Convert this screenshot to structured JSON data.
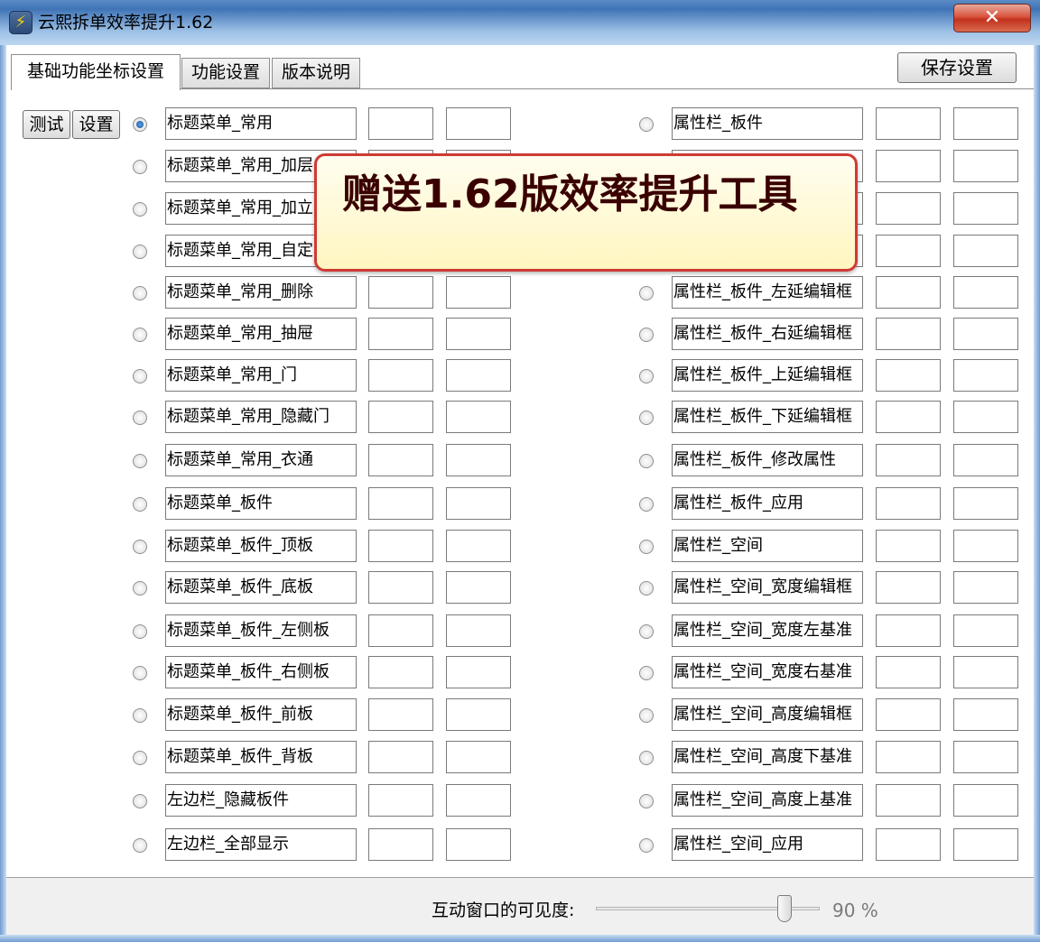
{
  "window": {
    "title": "云熙拆单效率提升1.62",
    "close_label": "✕",
    "app_icon_glyph": "⚡"
  },
  "tabs": [
    {
      "label": "基础功能坐标设置",
      "active": true
    },
    {
      "label": "功能设置",
      "active": false
    },
    {
      "label": "版本说明",
      "active": false
    }
  ],
  "toolbar": {
    "save_label": "保存设置",
    "test_label": "测试",
    "set_label": "设置"
  },
  "left_items": [
    {
      "label": "标题菜单_常用",
      "checked": true
    },
    {
      "label": "标题菜单_常用_加层",
      "checked": false
    },
    {
      "label": "标题菜单_常用_加立",
      "checked": false
    },
    {
      "label": "标题菜单_常用_自定",
      "checked": false
    },
    {
      "label": "标题菜单_常用_删除",
      "checked": false
    },
    {
      "label": "标题菜单_常用_抽屉",
      "checked": false
    },
    {
      "label": "标题菜单_常用_门",
      "checked": false
    },
    {
      "label": "标题菜单_常用_隐藏门",
      "checked": false
    },
    {
      "label": "标题菜单_常用_衣通",
      "checked": false
    },
    {
      "label": "标题菜单_板件",
      "checked": false
    },
    {
      "label": "标题菜单_板件_顶板",
      "checked": false
    },
    {
      "label": "标题菜单_板件_底板",
      "checked": false
    },
    {
      "label": "标题菜单_板件_左侧板",
      "checked": false
    },
    {
      "label": "标题菜单_板件_右侧板",
      "checked": false
    },
    {
      "label": "标题菜单_板件_前板",
      "checked": false
    },
    {
      "label": "标题菜单_板件_背板",
      "checked": false
    },
    {
      "label": "左边栏_隐藏板件",
      "checked": false
    },
    {
      "label": "左边栏_全部显示",
      "checked": false
    }
  ],
  "right_items": [
    {
      "label": "属性栏_板件",
      "checked": false
    },
    {
      "label": "",
      "checked": false
    },
    {
      "label": "",
      "checked": false
    },
    {
      "label": "",
      "checked": false
    },
    {
      "label": "属性栏_板件_左延编辑框",
      "checked": false
    },
    {
      "label": "属性栏_板件_右延编辑框",
      "checked": false
    },
    {
      "label": "属性栏_板件_上延编辑框",
      "checked": false
    },
    {
      "label": "属性栏_板件_下延编辑框",
      "checked": false
    },
    {
      "label": "属性栏_板件_修改属性",
      "checked": false
    },
    {
      "label": "属性栏_板件_应用",
      "checked": false
    },
    {
      "label": "属性栏_空间",
      "checked": false
    },
    {
      "label": "属性栏_空间_宽度编辑框",
      "checked": false
    },
    {
      "label": "属性栏_空间_宽度左基准",
      "checked": false
    },
    {
      "label": "属性栏_空间_宽度右基准",
      "checked": false
    },
    {
      "label": "属性栏_空间_高度编辑框",
      "checked": false
    },
    {
      "label": "属性栏_空间_高度下基准",
      "checked": false
    },
    {
      "label": "属性栏_空间_高度上基准",
      "checked": false
    },
    {
      "label": "属性栏_空间_应用",
      "checked": false
    }
  ],
  "banner": {
    "text": "赠送1.62版效率提升工具"
  },
  "footer": {
    "visibility_label": "互动窗口的可见度:",
    "visibility_value": "90 %",
    "visibility_percent": 90
  }
}
